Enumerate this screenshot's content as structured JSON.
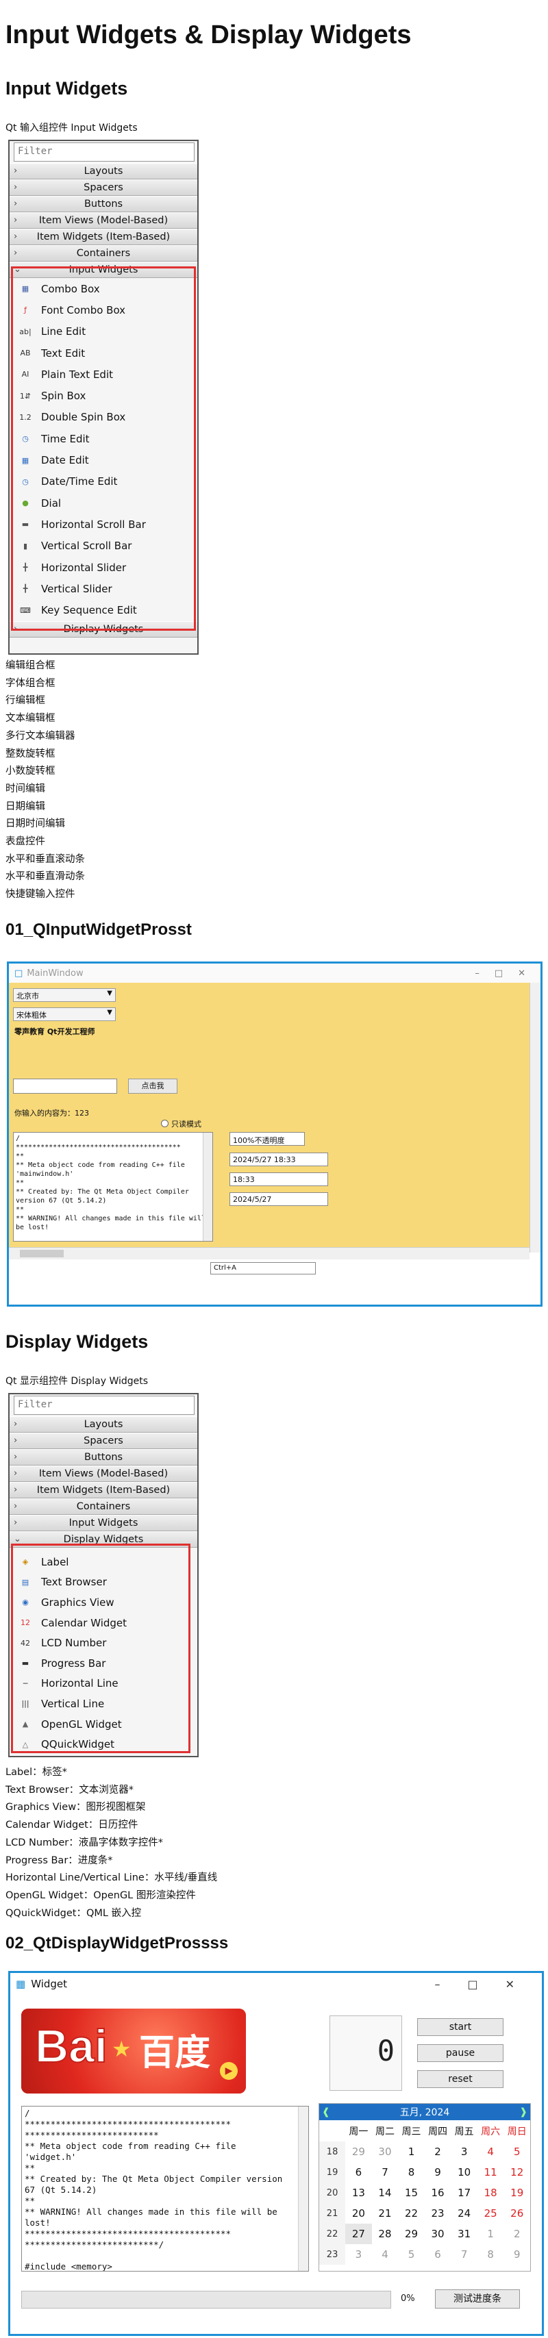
{
  "title": "Input Widgets & Display Widgets",
  "colors": {
    "highlight": "#e03030",
    "window_border": "#1e90d6",
    "panel_yellow": "#f7d97a",
    "calendar_header": "#1e6fc4"
  },
  "input_section": {
    "heading": "Input Widgets",
    "note": "Qt 输入组控件 Input Widgets",
    "widget_box": {
      "filter": "Filter",
      "categories_top": [
        "Layouts",
        "Spacers",
        "Buttons",
        "Item Views (Model-Based)",
        "Item Widgets (Item-Based)",
        "Containers"
      ],
      "open_category": "Input Widgets",
      "items": [
        "Combo Box",
        "Font Combo Box",
        "Line Edit",
        "Text Edit",
        "Plain Text Edit",
        "Spin Box",
        "Double Spin Box",
        "Time Edit",
        "Date Edit",
        "Date/Time Edit",
        "Dial",
        "Horizontal Scroll Bar",
        "Vertical Scroll Bar",
        "Horizontal Slider",
        "Vertical Slider",
        "Key Sequence Edit"
      ],
      "bottom_category": "Display Widgets"
    },
    "translations": [
      "编辑组合框",
      "字体组合框",
      "行编辑框",
      "文本编辑框",
      "多行文本编辑器",
      "整数旋转框",
      "小数旋转框",
      "时间编辑",
      "日期编辑",
      "日期时间编辑",
      "表盘控件",
      "水平和垂直滚动条",
      "水平和垂直滑动条",
      "快捷键输入控件"
    ]
  },
  "app1": {
    "heading": "01_QInputWidgetProsst",
    "window_title": "MainWindow",
    "combo1": "北京市",
    "combo2": "宋体粗体",
    "bold_label": "零声教育 Qt开发工程师",
    "button": "点击我",
    "count_label": "你输入的内容为：123",
    "radio": "只读模式",
    "text": "/\n****************************************\n**\n** Meta object code from reading C++ file\n'mainwindow.h'\n**\n** Created by: The Qt Meta Object Compiler\nversion 67 (Qt 5.14.2)\n**\n** WARNING! All changes made in this file will\nbe lost!",
    "opacity": "100%不透明度",
    "datetime": "2024/5/27 18:33",
    "time": "18:33",
    "date": "2024/5/27",
    "keyseq": "Ctrl+A"
  },
  "display_section": {
    "heading": "Display Widgets",
    "note": "Qt 显示组控件 Display Widgets",
    "widget_box": {
      "filter": "Filter",
      "categories_top": [
        "Layouts",
        "Spacers",
        "Buttons",
        "Item Views (Model-Based)",
        "Item Widgets (Item-Based)",
        "Containers",
        "Input Widgets"
      ],
      "open_category": "Display Widgets",
      "items": [
        "Label",
        "Text Browser",
        "Graphics View",
        "Calendar Widget",
        "LCD Number",
        "Progress Bar",
        "Horizontal Line",
        "Vertical Line",
        "OpenGL Widget",
        "QQuickWidget"
      ]
    },
    "translations": [
      "Label：标签*",
      "Text Browser：文本浏览器*",
      "Graphics View：图形视图框架",
      "Calendar Widget：日历控件",
      "LCD Number：液晶字体数字控件*",
      "Progress Bar：进度条*",
      "Horizontal Line/Vertical Line：水平线/垂直线",
      "OpenGL Widget：OpenGL 图形渲染控件",
      "QQuickWidget：QML 嵌入控"
    ]
  },
  "app2": {
    "heading": "02_QtDisplayWidgetProssss",
    "window_title": "Widget",
    "logo_left": "Bai",
    "logo_right": "百度",
    "lcd": "0",
    "buttons": [
      "start",
      "pause",
      "reset"
    ],
    "text": "/\n****************************************\n**************************\n** Meta object code from reading C++ file\n'widget.h'\n**\n** Created by: The Qt Meta Object Compiler version\n67 (Qt 5.14.2)\n**\n** WARNING! All changes made in this file will be\nlost!\n****************************************\n**************************/\n\n#include <memory>",
    "calendar": {
      "month": "五月, 2024",
      "weekdays": [
        "周一",
        "周二",
        "周三",
        "周四",
        "周五",
        "周六",
        "周日"
      ],
      "weeks": [
        [
          "18",
          "29",
          "30",
          "1",
          "2",
          "3",
          "4",
          "5"
        ],
        [
          "19",
          "6",
          "7",
          "8",
          "9",
          "10",
          "11",
          "12"
        ],
        [
          "20",
          "13",
          "14",
          "15",
          "16",
          "17",
          "18",
          "19"
        ],
        [
          "21",
          "20",
          "21",
          "22",
          "23",
          "24",
          "25",
          "26"
        ],
        [
          "22",
          "27",
          "28",
          "29",
          "30",
          "31",
          "1",
          "2"
        ],
        [
          "23",
          "3",
          "4",
          "5",
          "6",
          "7",
          "8",
          "9"
        ]
      ]
    },
    "progress": "0%",
    "progress_value": 0,
    "test_button": "测试进度条"
  }
}
